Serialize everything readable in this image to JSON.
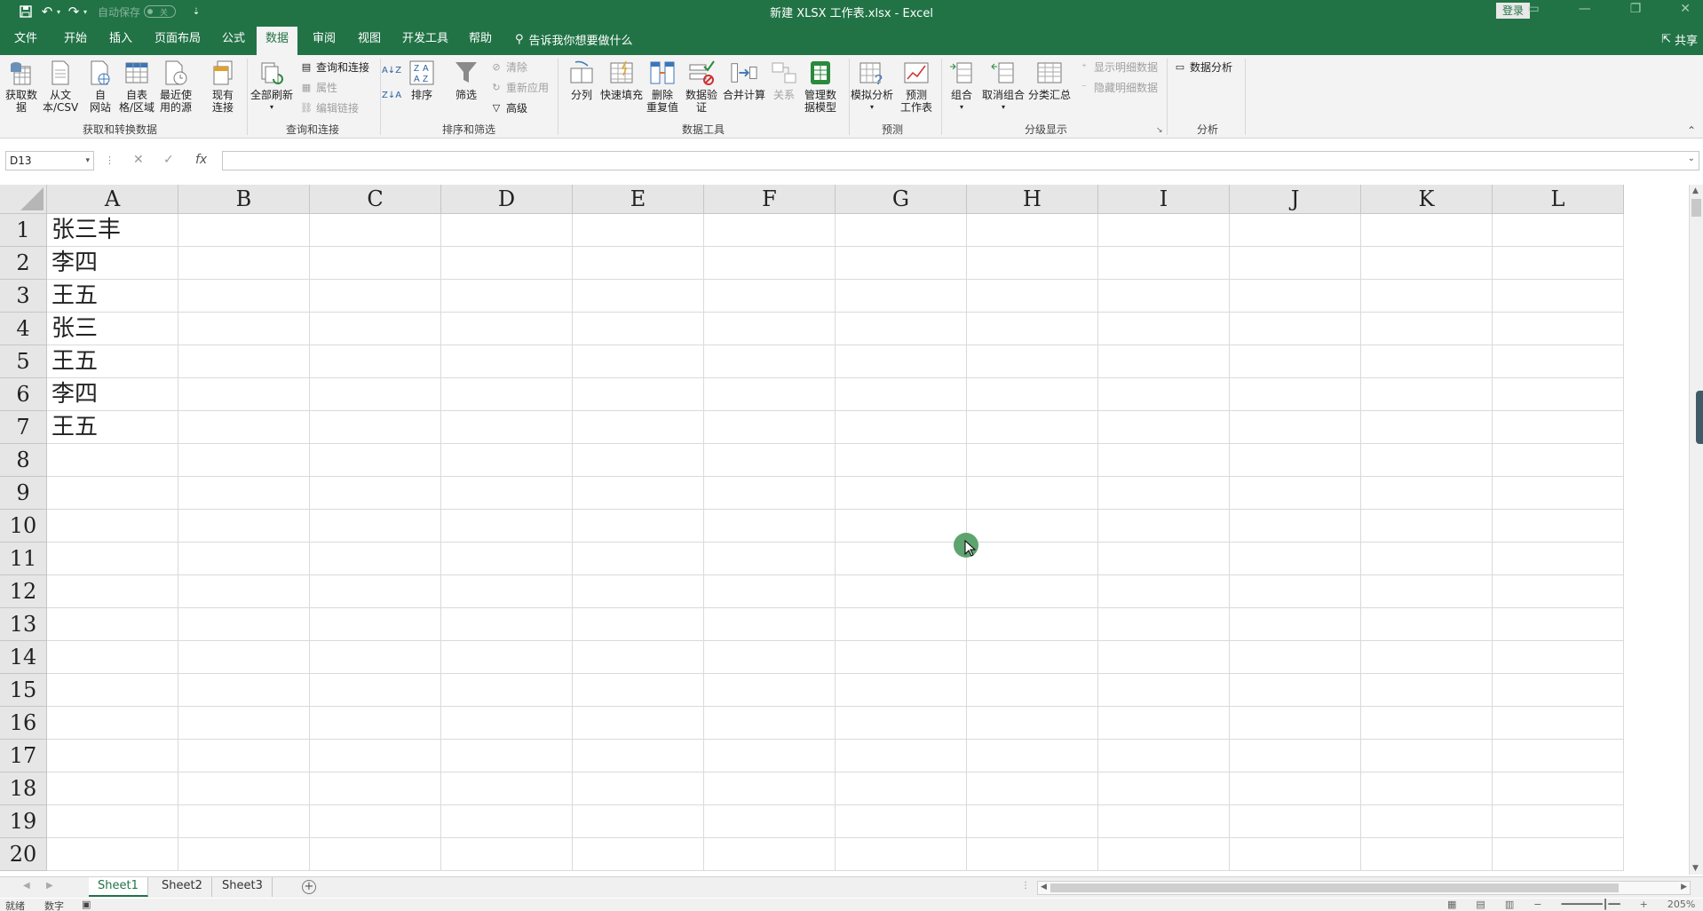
{
  "titlebar": {
    "autosave_label": "自动保存",
    "autosave_state": "关",
    "doc_title": "新建 XLSX 工作表.xlsx  -  Excel",
    "login": "登录"
  },
  "tabs": [
    {
      "label": "文件"
    },
    {
      "label": "开始"
    },
    {
      "label": "插入"
    },
    {
      "label": "页面布局"
    },
    {
      "label": "公式"
    },
    {
      "label": "数据"
    },
    {
      "label": "审阅"
    },
    {
      "label": "视图"
    },
    {
      "label": "开发工具"
    },
    {
      "label": "帮助"
    }
  ],
  "tellme": "告诉我你想要做什么",
  "share": "共享",
  "ribbon": {
    "get_data": "获取数\n据",
    "from_text": "从文\n本/CSV",
    "from_web": "自\n网站",
    "from_table": "自表\n格/区域",
    "recent_sources": "最近使\n用的源",
    "existing_conn": "现有\n连接",
    "group_get": "获取和转换数据",
    "refresh_all": "全部刷新",
    "queries_conn": "查询和连接",
    "properties": "属性",
    "edit_links": "编辑链接",
    "group_query": "查询和连接",
    "sort": "排序",
    "filter": "筛选",
    "clear": "清除",
    "reapply": "重新应用",
    "advanced": "高级",
    "group_sort": "排序和筛选",
    "text_to_cols": "分列",
    "flash_fill": "快速填充",
    "remove_dup": "删除\n重复值",
    "data_valid": "数据验\n证",
    "consolidate": "合并计算",
    "relations": "关系",
    "data_model": "管理数\n据模型",
    "group_tools": "数据工具",
    "what_if": "模拟分析",
    "forecast": "预测\n工作表",
    "group_forecast": "预测",
    "group_btn": "组合",
    "ungroup": "取消组合",
    "subtotal": "分类汇总",
    "show_detail": "显示明细数据",
    "hide_detail": "隐藏明细数据",
    "group_outline": "分级显示",
    "data_analysis": "数据分析",
    "group_analysis": "分析"
  },
  "formula_bar": {
    "name_box": "D13",
    "formula": ""
  },
  "columns": [
    "A",
    "B",
    "C",
    "D",
    "E",
    "F",
    "G",
    "H",
    "I",
    "J",
    "K",
    "L"
  ],
  "rows": [
    "1",
    "2",
    "3",
    "4",
    "5",
    "6",
    "7",
    "8",
    "9",
    "10",
    "11",
    "12",
    "13",
    "14",
    "15",
    "16",
    "17",
    "18",
    "19",
    "20"
  ],
  "cells": {
    "A1": "张三丰",
    "A2": "李四",
    "A3": "王五",
    "A4": "张三",
    "A5": "王五",
    "A6": "李四",
    "A7": "王五"
  },
  "sheets": [
    {
      "label": "Sheet1",
      "active": true
    },
    {
      "label": "Sheet2",
      "active": false
    },
    {
      "label": "Sheet3",
      "active": false
    }
  ],
  "status": {
    "ready": "就绪",
    "numlock": "数字",
    "zoom": "205%"
  },
  "colors": {
    "brand": "#217346",
    "cursor": "#4c9a5f"
  }
}
